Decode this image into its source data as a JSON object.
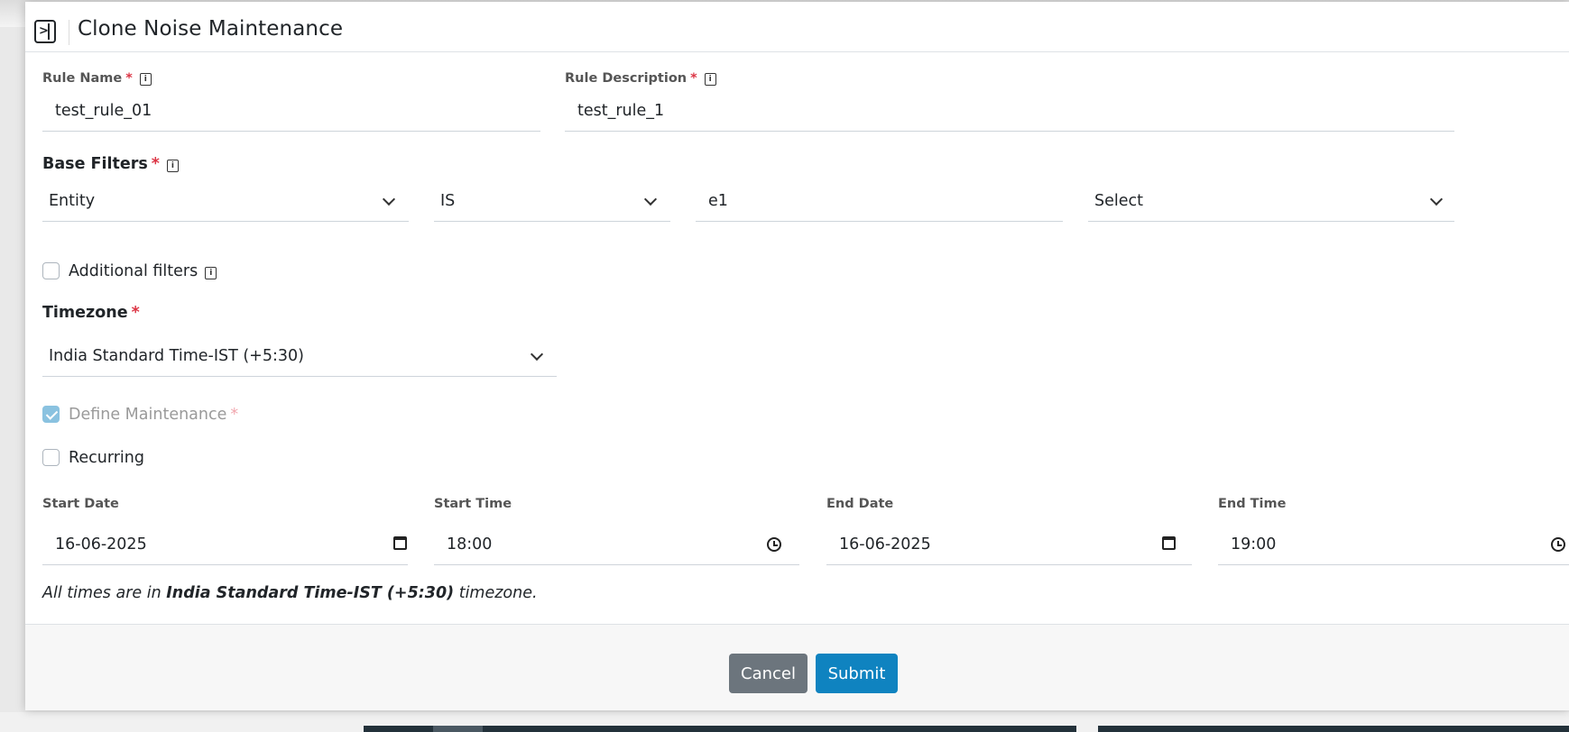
{
  "header": {
    "title": "Clone Noise Maintenance",
    "toggle_glyph": ">"
  },
  "rule_name": {
    "label": "Rule Name",
    "required": "*",
    "value": "test_rule_01"
  },
  "rule_description": {
    "label": "Rule Description",
    "required": "*",
    "value": "test_rule_1"
  },
  "base_filters": {
    "label": "Base Filters",
    "required": "*",
    "field": "Entity",
    "operator": "IS",
    "value": "e1",
    "extra": "Select"
  },
  "additional_filters": {
    "label": "Additional filters",
    "checked": false
  },
  "timezone": {
    "label": "Timezone",
    "required": "*",
    "value": "India Standard Time-IST (+5:30)"
  },
  "define_maintenance": {
    "label": "Define Maintenance",
    "required": "*",
    "checked": true,
    "disabled": true
  },
  "recurring": {
    "label": "Recurring",
    "checked": false
  },
  "schedule": {
    "start_date": {
      "label": "Start Date",
      "value": "16-06-2025"
    },
    "start_time": {
      "label": "Start Time",
      "value": "18:00"
    },
    "end_date": {
      "label": "End Date",
      "value": "16-06-2025"
    },
    "end_time": {
      "label": "End Time",
      "value": "19:00"
    }
  },
  "note": {
    "prefix": "All times are in",
    "timezone": "India Standard Time-IST (+5:30)",
    "suffix": "timezone."
  },
  "footer": {
    "cancel_label": "Cancel",
    "submit_label": "Submit"
  },
  "icons": {
    "info": "info-icon",
    "chevron": "chevron-down-icon",
    "calendar": "calendar-icon",
    "clock": "clock-icon",
    "sidebar": "sidebar-toggle-icon"
  },
  "colors": {
    "primary": "#0f83c0",
    "secondary": "#6c757d",
    "required": "#dc3545",
    "checkbox_checked": "#8ac2e0"
  }
}
